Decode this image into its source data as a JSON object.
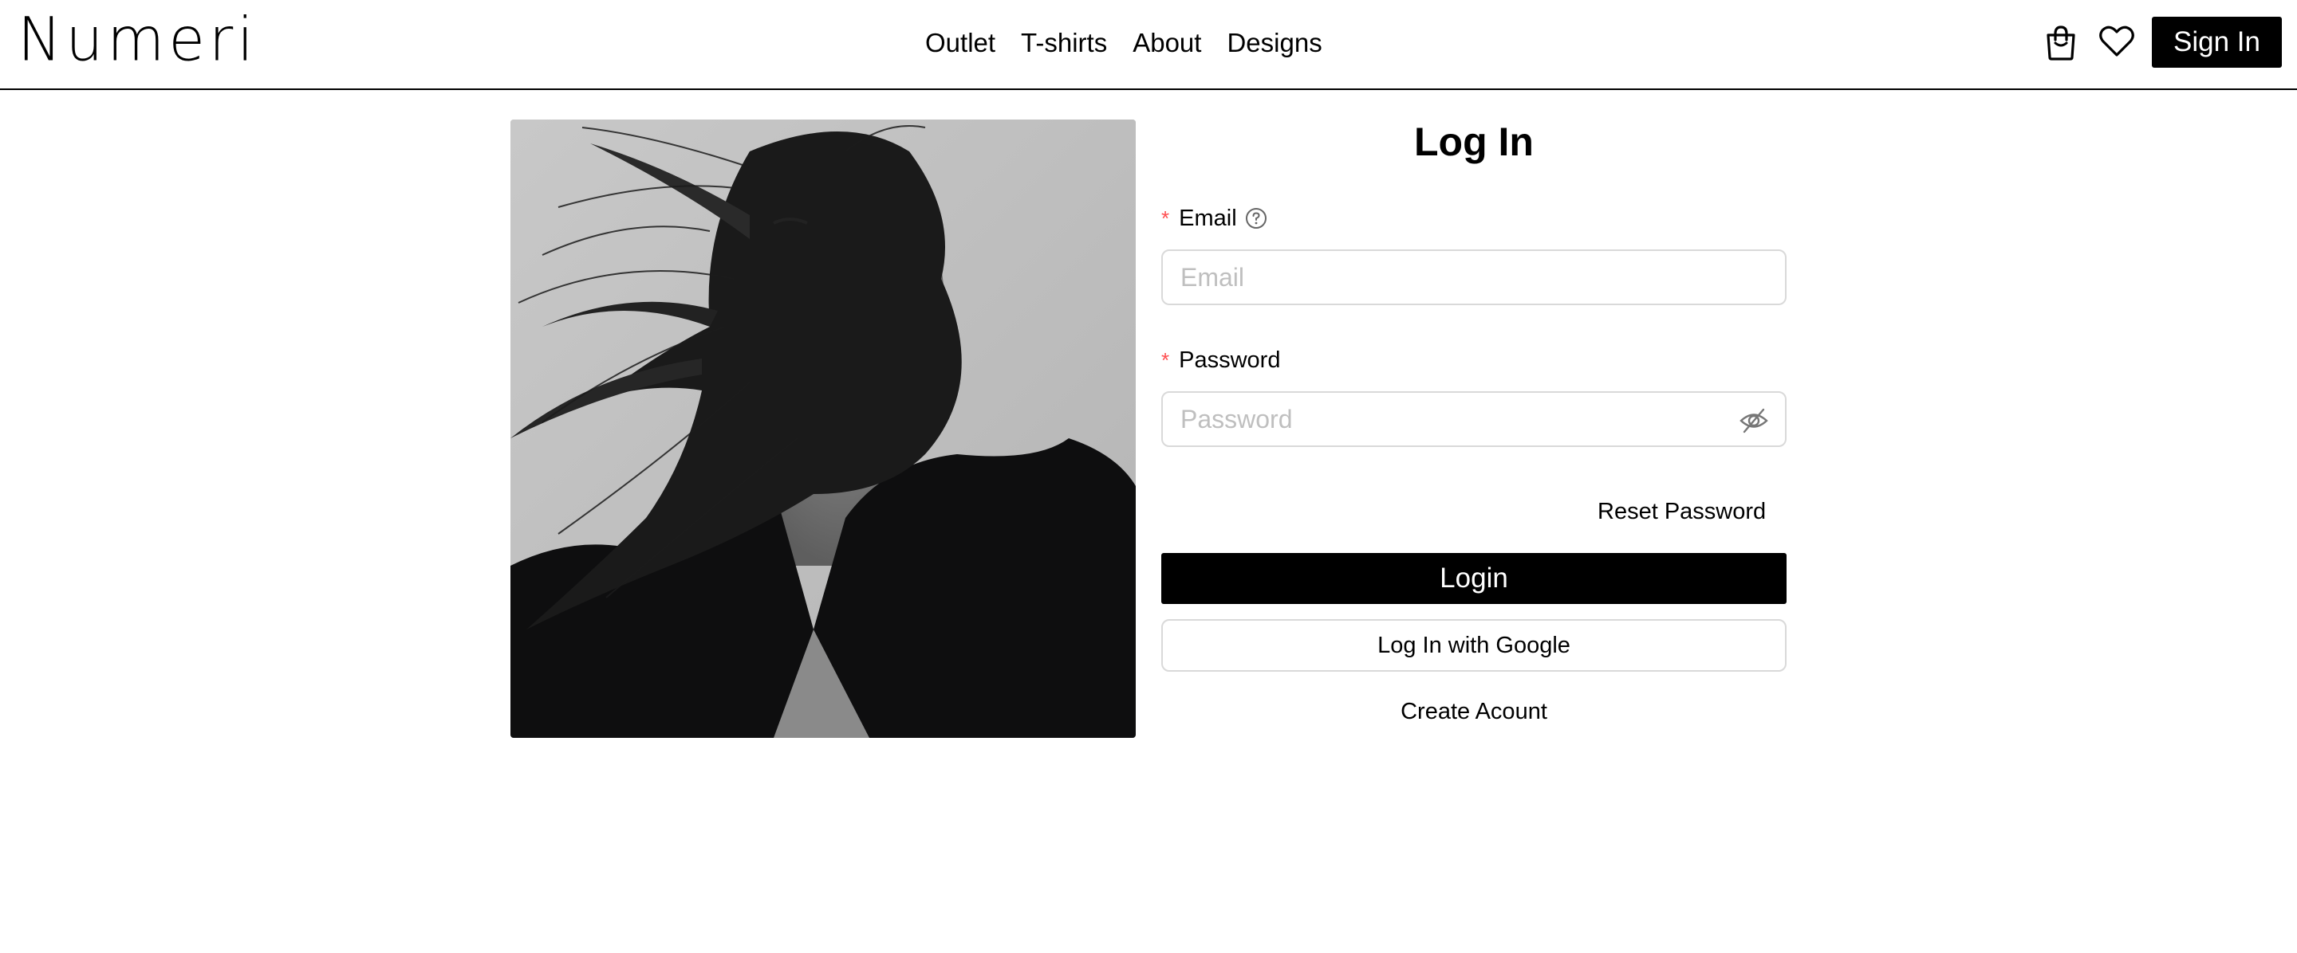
{
  "header": {
    "logo": "Numeri",
    "nav": [
      "Outlet",
      "T-shirts",
      "About",
      "Designs"
    ],
    "icons": [
      "shopping-bag-icon",
      "heart-icon"
    ],
    "signin_label": "Sign In"
  },
  "hero_image": {
    "alt": "black and white portrait with hair blowing across the face"
  },
  "form": {
    "title": "Log In",
    "email": {
      "required_mark": "*",
      "label": "Email",
      "placeholder": "Email",
      "value": "",
      "help_icon": "question-circle-icon"
    },
    "password": {
      "required_mark": "*",
      "label": "Password",
      "placeholder": "Password",
      "value": "",
      "toggle_icon": "eye-invisible-icon"
    },
    "reset_label": "Reset Password",
    "login_label": "Login",
    "google_label": "Log In with Google",
    "create_label": "Create Acount"
  },
  "colors": {
    "accent": "#000000",
    "required": "#ff4d4f",
    "border": "#d9d9d9",
    "placeholder": "#bfbfbf"
  }
}
